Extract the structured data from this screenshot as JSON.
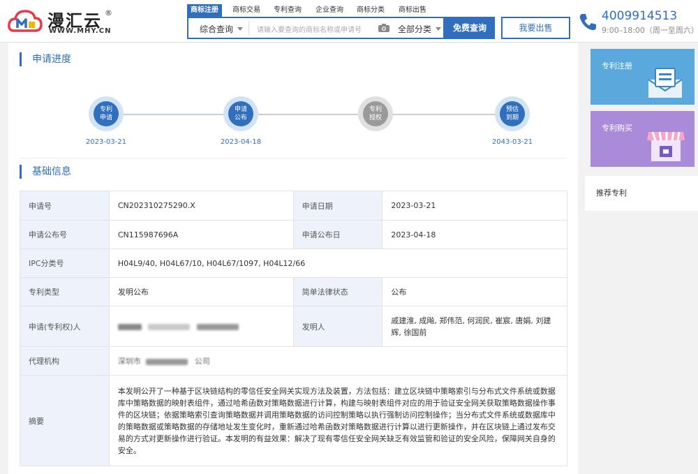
{
  "header": {
    "logo_text": "漫汇云",
    "logo_reg": "®",
    "logo_url": "WWW.MHY.CN",
    "tabs": [
      "商标注册",
      "商标交易",
      "专利查询",
      "企业查询",
      "商标分类",
      "商标出售"
    ],
    "search_type": "综合查询",
    "search_placeholder": "请输入要查询的商标名称或申请号",
    "category": "全部分类",
    "free_query": "免费查询",
    "sell": "我要出售",
    "phone": "4009914513",
    "hours": "9:00–18:00（周一至周六）"
  },
  "progress": {
    "title": "申请进度",
    "steps": [
      {
        "line1": "专利",
        "line2": "申请",
        "date": "2023-03-21",
        "active": true
      },
      {
        "line1": "申请",
        "line2": "公布",
        "date": "2023-04-18",
        "active": true
      },
      {
        "line1": "专利",
        "line2": "授权",
        "date": "",
        "active": false
      },
      {
        "line1": "预估",
        "line2": "到期",
        "date": "2043-03-21",
        "active": true
      }
    ]
  },
  "basic": {
    "title": "基础信息",
    "app_no_label": "申请号",
    "app_no": "CN202310275290.X",
    "app_date_label": "申请日期",
    "app_date": "2023-03-21",
    "pub_no_label": "申请公布号",
    "pub_no": "CN115987696A",
    "pub_date_label": "申请公布日",
    "pub_date": "2023-04-18",
    "ipc_label": "IPC分类号",
    "ipc": "H04L9/40, H04L67/10, H04L67/1097, H04L12/66",
    "type_label": "专利类型",
    "type": "发明公布",
    "legal_label": "简单法律状态",
    "legal": "公布",
    "applicant_label": "申请(专利权)人",
    "inventor_label": "发明人",
    "inventor": "戚建淮, 成飚, 郑伟范, 何润民, 崔宸, 唐娟, 刘建辉, 徐国前",
    "agency_label": "代理机构",
    "agency_partial": "深圳市",
    "agency_suffix": "公司",
    "abstract_label": "摘要",
    "abstract": "本发明公开了一种基于区块链结构的零信任安全网关实现方法及装置，方法包括：建立区块链中策略索引与分布式文件系统或数据库中策略数据的映射表组件，通过哈希函数对策略数据进行计算，构建与映射表组件对应的用于验证安全网关获取策略数据操作事件的区块链；依据策略索引查询策略数据并调用策略数据的访问控制策略以执行强制访问控制操作；当分布式文件系统或数据库中的策略数据或策略数据的存储地址发生变化时，重新通过哈希函数对策略数据进行计算以进行更新操作，并在区块链上通过发布交易的方式对更新操作进行验证。本发明的有益效果：解决了现有零信任安全网关缺乏有效监管和验证的安全风险，保障网关自身的安全。"
  },
  "sidebar": {
    "card1": "专利注册",
    "card2": "专利购买",
    "recommend": "推荐专利"
  },
  "colors": {
    "accent": "#2f6fbd",
    "node_active": "#2f6fbd",
    "node_inactive": "#9a9a9a",
    "card1": "#5aa8dc",
    "card2": "#a98bd9"
  }
}
